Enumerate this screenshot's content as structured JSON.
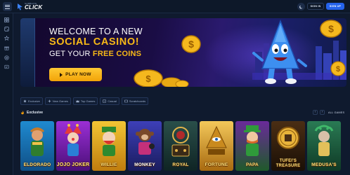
{
  "header": {
    "logo_small": "GAMBLING",
    "logo_big": "CLICK",
    "signin_label": "SIGN IN",
    "signup_label": "SIGN UP"
  },
  "hero": {
    "line1": "WELCOME TO A NEW",
    "line2": "SOCIAL CASINO!",
    "line3_prefix": "GET YOUR",
    "line3_highlight": "FREE COINS",
    "cta_label": "PLAY NOW"
  },
  "tabs": [
    {
      "label": "Exclusive",
      "icon": "star-icon"
    },
    {
      "label": "New Games",
      "icon": "sparkle-icon"
    },
    {
      "label": "Top Games",
      "icon": "crown-icon"
    },
    {
      "label": "Casual",
      "icon": "dice-icon"
    },
    {
      "label": "Scratchcards",
      "icon": "ticket-icon"
    }
  ],
  "section": {
    "title": "Exclusive",
    "all_games_label": "ALL GAMES"
  },
  "games": [
    {
      "name": "ELDORADO",
      "bg": "#1b6fa8"
    },
    {
      "name": "JOJO JOKER",
      "bg": "#6b1fa0"
    },
    {
      "name": "WILLIE",
      "bg": "#d8a21c"
    },
    {
      "name": "MONKEY",
      "bg": "#2b2f8f"
    },
    {
      "name": "ROYAL",
      "bg": "#1d3a3a"
    },
    {
      "name": "FORTUNE",
      "bg": "#d7a52a"
    },
    {
      "name": "PAPA",
      "bg": "#1e7a2e"
    },
    {
      "name": "TUFEI'S TREASURE",
      "bg": "#2a1a0e"
    },
    {
      "name": "MEDUSA'S",
      "bg": "#1a5a3a"
    }
  ],
  "colors": {
    "accent_blue": "#2563eb",
    "gold": "#f7b917",
    "bg": "#0f1a2e"
  }
}
